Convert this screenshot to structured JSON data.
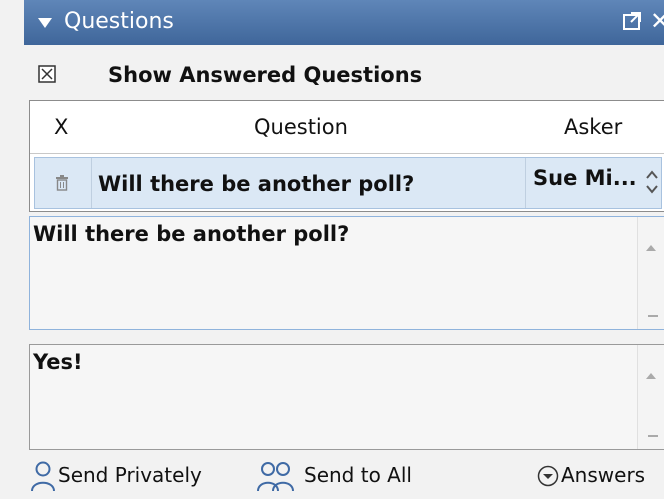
{
  "panel": {
    "title": "Questions"
  },
  "options": {
    "show_answered_label": "Show Answered Questions"
  },
  "table": {
    "columns": [
      "X",
      "Question",
      "Asker"
    ],
    "rows": [
      {
        "question": "Will there be another poll?",
        "asker": "Sue Mi..."
      }
    ]
  },
  "question_text": "Will there be another poll?",
  "answer_text": "Yes!",
  "footer": {
    "send_privately": "Send Privately",
    "send_to_all": "Send to All",
    "answers": "Answers"
  },
  "colors": {
    "header": "#4a72a6",
    "selected_row": "#dbe8f5",
    "icon_blue": "#3f6aa5"
  }
}
